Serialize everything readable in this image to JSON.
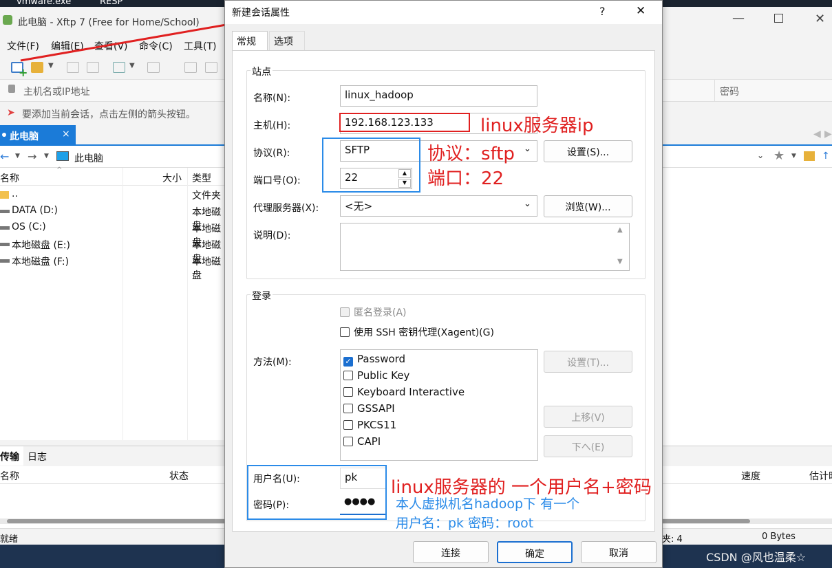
{
  "taskbar": {
    "item1": "vmware.exe",
    "item2": "RESP"
  },
  "app": {
    "title": "此电脑 - Xftp 7 (Free for Home/School)"
  },
  "menu": [
    "文件(F)",
    "编辑(E)",
    "查看(V)",
    "命令(C)",
    "工具(T)"
  ],
  "address": {
    "host_placeholder": "主机名或IP地址",
    "password_label": "密码"
  },
  "info": {
    "hint": "要添加当前会话，点击左侧的箭头按钮。"
  },
  "tab": {
    "label": "此电脑",
    "close": "×"
  },
  "path": {
    "location": "此电脑"
  },
  "files": {
    "columns": {
      "name": "名称",
      "size": "大小",
      "type": "类型"
    },
    "rows": [
      {
        "name": "..",
        "type": "文件夹"
      },
      {
        "name": "DATA (D:)",
        "type": "本地磁盘"
      },
      {
        "name": "OS (C:)",
        "type": "本地磁盘"
      },
      {
        "name": "本地磁盘 (E:)",
        "type": "本地磁盘"
      },
      {
        "name": "本地磁盘 (F:)",
        "type": "本地磁盘"
      }
    ]
  },
  "bottom": {
    "tab_transfer": "传输",
    "tab_log": "日志",
    "col_name": "名称",
    "col_status": "状态",
    "col_speed": "速度",
    "col_eta": "估计时"
  },
  "status": {
    "ready": "就绪",
    "files": "夹: 4",
    "bytes": "0 Bytes"
  },
  "watermark": "CSDN @风也温柔☆",
  "dialog": {
    "title": "新建会话属性",
    "help": "?",
    "close": "✕",
    "tabs": [
      "常规",
      "选项"
    ],
    "site": {
      "legend": "站点",
      "name_label": "名称(N):",
      "name_value": "linux_hadoop",
      "host_label": "主机(H):",
      "host_value": "192.168.123.133",
      "protocol_label": "协议(R):",
      "protocol_value": "SFTP",
      "settings_btn": "设置(S)...",
      "port_label": "端口号(O):",
      "port_value": "22",
      "proxy_label": "代理服务器(X):",
      "proxy_value": "<无>",
      "browse_btn": "浏览(W)...",
      "desc_label": "说明(D):"
    },
    "login": {
      "legend": "登录",
      "anon": "匿名登录(A)",
      "agent": "使用 SSH 密钥代理(Xagent)(G)",
      "method_label": "方法(M):",
      "methods": [
        "Password",
        "Public Key",
        "Keyboard Interactive",
        "GSSAPI",
        "PKCS11",
        "CAPI"
      ],
      "settings_btn": "设置(T)...",
      "up_btn": "上移(V)",
      "down_btn": "下へ(E)",
      "user_label": "用户名(U):",
      "user_value": "pk",
      "pass_label": "密码(P):",
      "pass_value": "●●●●"
    },
    "footer": {
      "connect": "连接",
      "ok": "确定",
      "cancel": "取消"
    }
  },
  "annotations": {
    "ip": "linux服务器ip",
    "proto": "协议：sftp",
    "port": "端口：22",
    "cred": "linux服务器的 一个用户名+密码",
    "note1": "本人虚拟机名hadoop下 有一个",
    "note2": "用户名：pk  密码：root"
  }
}
